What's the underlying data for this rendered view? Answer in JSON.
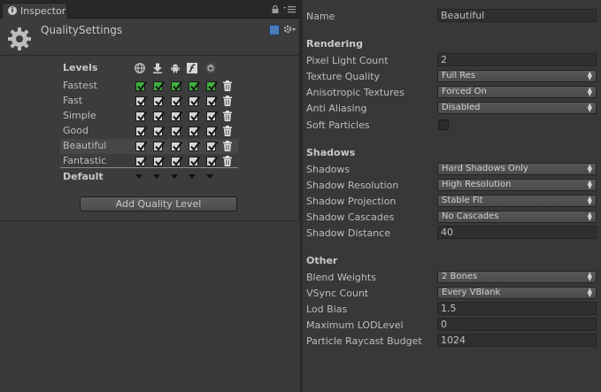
{
  "tab": {
    "label": "Inspector",
    "info_glyph": "i"
  },
  "header": {
    "title": "QualitySettings"
  },
  "levels": {
    "heading": "Levels",
    "platform_icons": [
      "globe-icon",
      "download-icon",
      "android-icon",
      "flash-icon",
      "blackberry-icon"
    ],
    "items": [
      {
        "name": "Fastest",
        "green": true
      },
      {
        "name": "Fast",
        "green": false
      },
      {
        "name": "Simple",
        "green": false
      },
      {
        "name": "Good",
        "green": false
      },
      {
        "name": "Beautiful",
        "green": false,
        "selected": true
      },
      {
        "name": "Fantastic",
        "green": false
      }
    ],
    "default_label": "Default",
    "add_button": "Add Quality Level"
  },
  "props": {
    "name_label": "Name",
    "name_value": "Beautiful",
    "rendering": {
      "heading": "Rendering",
      "pixel_light_count_label": "Pixel Light Count",
      "pixel_light_count_value": "2",
      "texture_quality_label": "Texture Quality",
      "texture_quality_value": "Full Res",
      "anisotropic_label": "Anisotropic Textures",
      "anisotropic_value": "Forced On",
      "anti_aliasing_label": "Anti Aliasing",
      "anti_aliasing_value": "Disabled",
      "soft_particles_label": "Soft Particles"
    },
    "shadows": {
      "heading": "Shadows",
      "shadows_label": "Shadows",
      "shadows_value": "Hard Shadows Only",
      "resolution_label": "Shadow Resolution",
      "resolution_value": "High Resolution",
      "projection_label": "Shadow Projection",
      "projection_value": "Stable Fit",
      "cascades_label": "Shadow Cascades",
      "cascades_value": "No Cascades",
      "distance_label": "Shadow Distance",
      "distance_value": "40"
    },
    "other": {
      "heading": "Other",
      "blend_weights_label": "Blend Weights",
      "blend_weights_value": "2 Bones",
      "vsync_label": "VSync Count",
      "vsync_value": "Every VBlank",
      "lod_bias_label": "Lod Bias",
      "lod_bias_value": "1.5",
      "max_lod_label": "Maximum LODLevel",
      "max_lod_value": "0",
      "raycast_label": "Particle Raycast Budget",
      "raycast_value": "1024"
    }
  },
  "colors": {
    "green_check": "#3fb03f",
    "gray_check": "#d6d6d6",
    "accent_help": "#4a7db8"
  }
}
